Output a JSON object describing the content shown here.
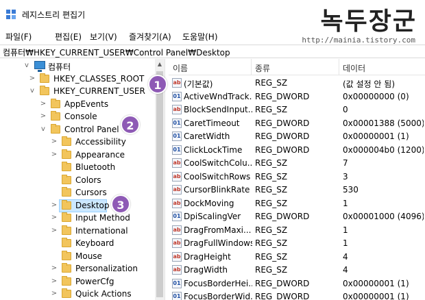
{
  "window": {
    "title": "레지스트리 편집기",
    "watermark": "녹두장군",
    "watermark_url": "http://mainia.tistory.com"
  },
  "menu": [
    {
      "label": "파일(F)"
    },
    {
      "label": "편집(E)"
    },
    {
      "label": "보기(V)"
    },
    {
      "label": "즐겨찾기(A)"
    },
    {
      "label": "도움말(H)"
    }
  ],
  "address": {
    "path": "컴퓨터₩HKEY_CURRENT_USER₩Control Panel₩Desktop"
  },
  "tree": [
    {
      "label": "컴퓨터",
      "depth": 0,
      "expander": "v",
      "icon": "computer-icon"
    },
    {
      "label": "HKEY_CLASSES_ROOT",
      "depth": 1,
      "expander": ">",
      "icon": "folder-icon"
    },
    {
      "label": "HKEY_CURRENT_USER",
      "depth": 1,
      "expander": "v",
      "icon": "folder-icon"
    },
    {
      "label": "AppEvents",
      "depth": 2,
      "expander": ">",
      "icon": "folder-icon"
    },
    {
      "label": "Console",
      "depth": 2,
      "expander": ">",
      "icon": "folder-icon"
    },
    {
      "label": "Control Panel",
      "depth": 2,
      "expander": "v",
      "icon": "folder-icon"
    },
    {
      "label": "Accessibility",
      "depth": 3,
      "expander": ">",
      "icon": "folder-icon"
    },
    {
      "label": "Appearance",
      "depth": 3,
      "expander": ">",
      "icon": "folder-icon"
    },
    {
      "label": "Bluetooth",
      "depth": 3,
      "expander": "",
      "icon": "folder-icon"
    },
    {
      "label": "Colors",
      "depth": 3,
      "expander": "",
      "icon": "folder-icon"
    },
    {
      "label": "Cursors",
      "depth": 3,
      "expander": "",
      "icon": "folder-icon"
    },
    {
      "label": "Desktop",
      "depth": 3,
      "expander": ">",
      "icon": "folder-icon",
      "selected": true
    },
    {
      "label": "Input Method",
      "depth": 3,
      "expander": ">",
      "icon": "folder-icon"
    },
    {
      "label": "International",
      "depth": 3,
      "expander": ">",
      "icon": "folder-icon"
    },
    {
      "label": "Keyboard",
      "depth": 3,
      "expander": "",
      "icon": "folder-icon"
    },
    {
      "label": "Mouse",
      "depth": 3,
      "expander": "",
      "icon": "folder-icon"
    },
    {
      "label": "Personalization",
      "depth": 3,
      "expander": ">",
      "icon": "folder-icon"
    },
    {
      "label": "PowerCfg",
      "depth": 3,
      "expander": ">",
      "icon": "folder-icon"
    },
    {
      "label": "Quick Actions",
      "depth": 3,
      "expander": ">",
      "icon": "folder-icon"
    }
  ],
  "columns": {
    "name": "이름",
    "type": "종류",
    "data": "데이터"
  },
  "values": [
    {
      "name": "(기본값)",
      "type": "REG_SZ",
      "data": "(값 설정 안 됨)",
      "kind": "sz"
    },
    {
      "name": "ActiveWndTrack...",
      "type": "REG_DWORD",
      "data": "0x00000000 (0)",
      "kind": "dw"
    },
    {
      "name": "BlockSendInput...",
      "type": "REG_SZ",
      "data": "0",
      "kind": "sz"
    },
    {
      "name": "CaretTimeout",
      "type": "REG_DWORD",
      "data": "0x00001388 (5000)",
      "kind": "dw"
    },
    {
      "name": "CaretWidth",
      "type": "REG_DWORD",
      "data": "0x00000001 (1)",
      "kind": "dw"
    },
    {
      "name": "ClickLockTime",
      "type": "REG_DWORD",
      "data": "0x000004b0 (1200)",
      "kind": "dw"
    },
    {
      "name": "CoolSwitchColu...",
      "type": "REG_SZ",
      "data": "7",
      "kind": "sz"
    },
    {
      "name": "CoolSwitchRows",
      "type": "REG_SZ",
      "data": "3",
      "kind": "sz"
    },
    {
      "name": "CursorBlinkRate",
      "type": "REG_SZ",
      "data": "530",
      "kind": "sz"
    },
    {
      "name": "DockMoving",
      "type": "REG_SZ",
      "data": "1",
      "kind": "sz"
    },
    {
      "name": "DpiScalingVer",
      "type": "REG_DWORD",
      "data": "0x00001000 (4096)",
      "kind": "dw"
    },
    {
      "name": "DragFromMaxi...",
      "type": "REG_SZ",
      "data": "1",
      "kind": "sz"
    },
    {
      "name": "DragFullWindows",
      "type": "REG_SZ",
      "data": "1",
      "kind": "sz"
    },
    {
      "name": "DragHeight",
      "type": "REG_SZ",
      "data": "4",
      "kind": "sz"
    },
    {
      "name": "DragWidth",
      "type": "REG_SZ",
      "data": "4",
      "kind": "sz"
    },
    {
      "name": "FocusBorderHei...",
      "type": "REG_DWORD",
      "data": "0x00000001 (1)",
      "kind": "dw"
    },
    {
      "name": "FocusBorderWid...",
      "type": "REG_DWORD",
      "data": "0x00000001 (1)",
      "kind": "dw"
    }
  ],
  "value_icon_text": {
    "sz": "ab",
    "dw": "01"
  },
  "badges": [
    {
      "label": "1"
    },
    {
      "label": "2"
    },
    {
      "label": "3"
    }
  ]
}
